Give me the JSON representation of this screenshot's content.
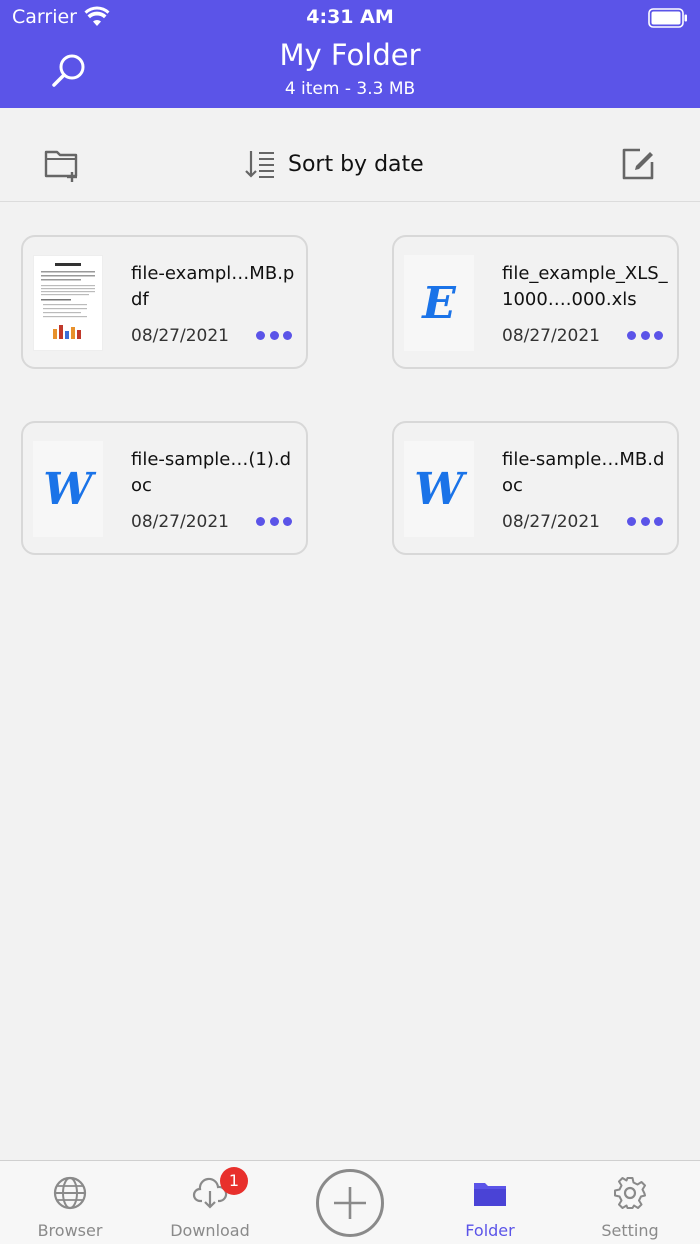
{
  "status_bar": {
    "carrier": "Carrier",
    "time": "4:31 AM"
  },
  "header": {
    "title": "My Folder",
    "subtitle": "4 item - 3.3 MB"
  },
  "toolbar": {
    "sort_label": "Sort by date"
  },
  "files": [
    {
      "name": "file-exampl…MB.pdf",
      "date": "08/27/2021",
      "type": "pdf",
      "icon": "pdf-thumbnail"
    },
    {
      "name": "file_example_XLS_1000….000.xls",
      "date": "08/27/2021",
      "type": "xls",
      "icon": "E"
    },
    {
      "name": "file-sample…(1).doc",
      "date": "08/27/2021",
      "type": "doc",
      "icon": "W"
    },
    {
      "name": "file-sample…MB.doc",
      "date": "08/27/2021",
      "type": "doc",
      "icon": "W"
    }
  ],
  "tabbar": {
    "tabs": [
      {
        "label": "Browser",
        "icon": "globe-icon"
      },
      {
        "label": "Download",
        "icon": "cloud-download-icon",
        "badge": "1"
      },
      {
        "label": "",
        "icon": "add-icon"
      },
      {
        "label": "Folder",
        "icon": "folder-icon"
      },
      {
        "label": "Setting",
        "icon": "gear-icon"
      }
    ],
    "active": "Folder"
  },
  "colors": {
    "accent": "#5b54e8",
    "badge": "#e8302c",
    "doc_icon": "#1a73e8"
  }
}
